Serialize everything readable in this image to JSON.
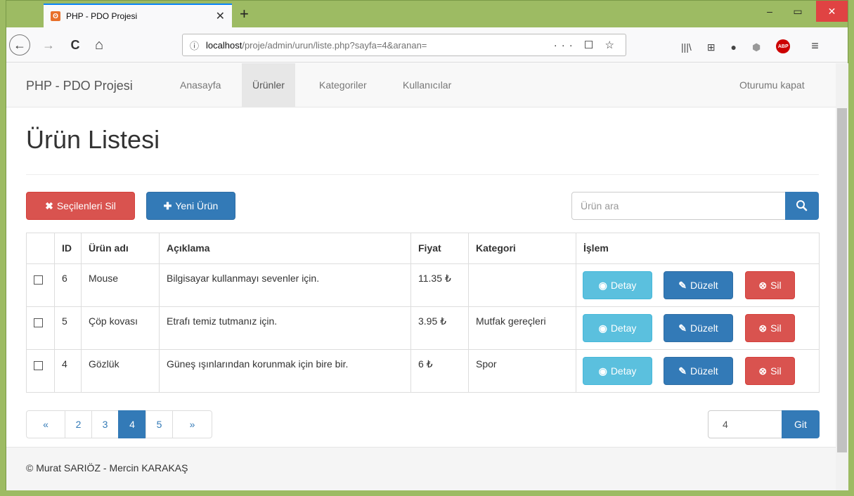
{
  "browser": {
    "tab_title": "PHP - PDO Projesi",
    "tab_favicon": "ʘ",
    "tab_close": "✕",
    "new_tab": "+",
    "minimize": "‒",
    "maximize": "▭",
    "close": "✕",
    "back": "←",
    "forward": "→",
    "reload": "C",
    "home": "⌂",
    "info_icon": "ⓘ",
    "url_host": "localhost",
    "url_rest": "/proje/admin/urun/liste.php?sayfa=4&aranan=",
    "url_actions": "··· ☐ ☆",
    "library_icon": "|||\\",
    "reader_icon": "⊞",
    "ext1_icon": "●",
    "shield_icon": "⬢",
    "abp": "ABP",
    "menu_icon": "≡"
  },
  "site": {
    "brand": "PHP - PDO Projesi",
    "nav": [
      {
        "label": "Anasayfa"
      },
      {
        "label": "Ürünler"
      },
      {
        "label": "Kategoriler"
      },
      {
        "label": "Kullanıcılar"
      }
    ],
    "logout": "Oturumu kapat"
  },
  "page": {
    "title": "Ürün Listesi",
    "delete_selected": "Seçilenleri Sil",
    "delete_selected_icon": "✖",
    "new_product": "Yeni Ürün",
    "new_product_icon": "✚",
    "search_placeholder": "Ürün ara",
    "search_icon": "⚲"
  },
  "table": {
    "headers": [
      "",
      "ID",
      "Ürün adı",
      "Açıklama",
      "Fiyat",
      "Kategori",
      "İşlem"
    ],
    "rows": [
      {
        "id": "6",
        "name": "Mouse",
        "desc": "Bilgisayar kullanmayı sevenler için.",
        "price": "11.35 ₺",
        "category": ""
      },
      {
        "id": "5",
        "name": "Çöp kovası",
        "desc": "Etrafı temiz tutmanız için.",
        "price": "3.95 ₺",
        "category": "Mutfak gereçleri"
      },
      {
        "id": "4",
        "name": "Gözlük",
        "desc": "Güneş ışınlarından korunmak için bire bir.",
        "price": "6 ₺",
        "category": "Spor"
      }
    ],
    "detail": "Detay",
    "detail_icon": "◉",
    "edit": "Düzelt",
    "edit_icon": "✎",
    "delete": "Sil",
    "delete_icon": "⊗"
  },
  "pagination": {
    "prev": "«",
    "pages": [
      "2",
      "3",
      "4",
      "5"
    ],
    "active": "4",
    "next": "»",
    "goto_value": "4",
    "goto_label": "Git"
  },
  "footer": {
    "text": "© Murat SARIÖZ - Mercin KARAKAŞ"
  }
}
